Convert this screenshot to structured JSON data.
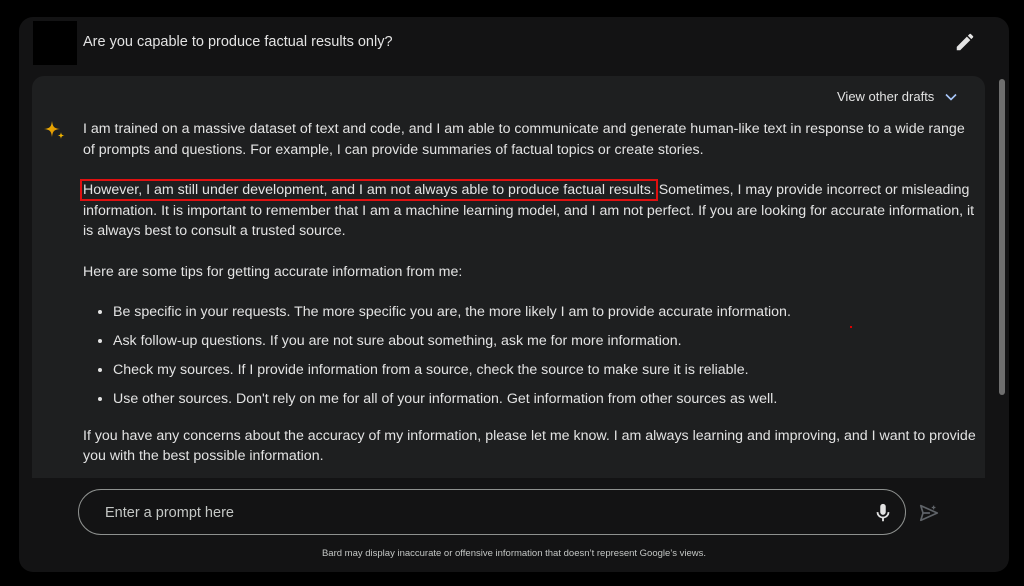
{
  "header": {
    "question": "Are you capable to produce factual results only?",
    "edit_icon": "pencil-icon"
  },
  "response": {
    "drafts_label": "View other drafts",
    "drafts_icon": "chevron-down-icon",
    "avatar_icon": "sparkle-icon",
    "para1": "I am trained on a massive dataset of text and code, and I am able to communicate and generate human-like text in response to a wide range of prompts and questions. For example, I can provide summaries of factual topics or create stories.",
    "para2_highlight": "However, I am still under development, and I am not always able to produce factual results.",
    "para2_rest": " Sometimes, I may provide incorrect or misleading information. It is important to remember that I am a machine learning model, and I am not perfect. If you are looking for accurate information, it is always best to consult a trusted source.",
    "tips_intro": "Here are some tips for getting accurate information from me:",
    "tips": [
      "Be specific in your requests. The more specific you are, the more likely I am to provide accurate information.",
      "Ask follow-up questions. If you are not sure about something, ask me for more information.",
      "Check my sources. If I provide information from a source, check the source to make sure it is reliable.",
      "Use other sources. Don't rely on me for all of your information. Get information from other sources as well."
    ],
    "closing": "If you have any concerns about the accuracy of my information, please let me know. I am always learning and improving, and I want to provide you with the best possible information."
  },
  "input": {
    "placeholder": "Enter a prompt here",
    "mic_icon": "microphone-icon",
    "send_icon": "send-icon"
  },
  "footer": {
    "disclaimer": "Bard may display inaccurate or offensive information that doesn’t represent Google’s views."
  },
  "colors": {
    "background": "#131314",
    "response_bg": "#1e1f20",
    "text": "#e3e3e3",
    "highlight_box": "#e01010"
  }
}
